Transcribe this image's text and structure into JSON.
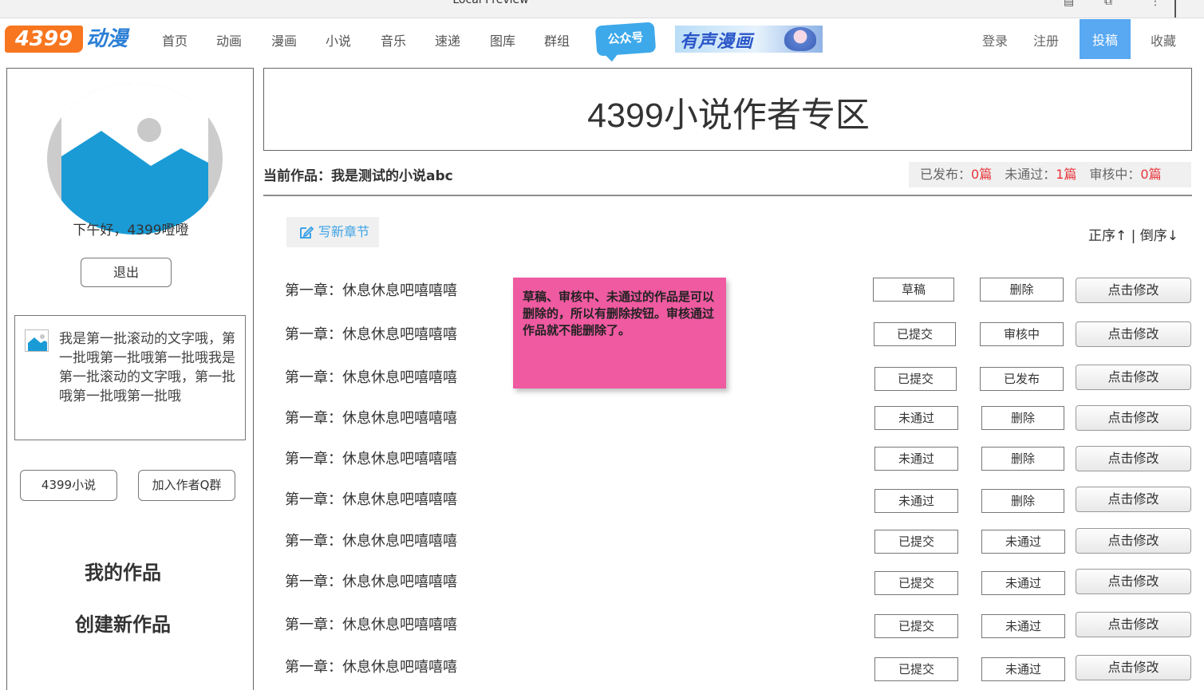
{
  "window": {
    "title": "Local Preview"
  },
  "topnav": {
    "logo_number": "4399",
    "logo_text": "动漫",
    "items": [
      "首页",
      "动画",
      "漫画",
      "小说",
      "音乐",
      "速递",
      "图库",
      "群组"
    ],
    "badge_gongzhonghao": "公众号",
    "banner_text": "有声漫画",
    "login": "登录",
    "register": "注册",
    "submit": "投稿",
    "favorites": "收藏",
    "accent_color": "#58a8f2",
    "logo_color": "#f7761f"
  },
  "sidebar": {
    "greeting": "下午好，4399噔噔",
    "logout_label": "退出",
    "scroll_text": "我是第一批滚动的文字哦，第一批哦第一批哦第一批哦我是第一批滚动的文字哦，第一批哦第一批哦第一批哦",
    "btn_novel": "4399小说",
    "btn_join_group": "加入作者Q群",
    "link_my_works": "我的作品",
    "link_create_work": "创建新作品"
  },
  "main": {
    "header_title": "4399小说作者专区",
    "current_work_label": "当前作品：",
    "current_work_name": "我是测试的小说abc",
    "stats": {
      "published_label": "已发布：",
      "published_count": "0篇",
      "rejected_label": "未通过：",
      "rejected_count": "1篇",
      "reviewing_label": "审核中：",
      "reviewing_count": "0篇",
      "highlight_color": "#e8343a"
    },
    "write_chapter_label": "写新章节",
    "sort_label": "正序↑ | 倒序↓",
    "note_text": "草稿、审核中、未通过的作品是可以删除的，所以有删除按钮。审核通过作品就不能删除了。",
    "note_color": "#ef5aa1",
    "edit_label": "点击修改",
    "chapters": [
      {
        "title": "第一章：休息休息吧嘻嘻嘻",
        "status": "草稿",
        "action": "删除"
      },
      {
        "title": "第一章：休息休息吧嘻嘻嘻",
        "status": "已提交",
        "action": "审核中"
      },
      {
        "title": "第一章：休息休息吧嘻嘻嘻",
        "status": "已提交",
        "action": "已发布"
      },
      {
        "title": "第一章：休息休息吧嘻嘻嘻",
        "status": "未通过",
        "action": "删除"
      },
      {
        "title": "第一章：休息休息吧嘻嘻嘻",
        "status": "未通过",
        "action": "删除"
      },
      {
        "title": "第一章：休息休息吧嘻嘻嘻",
        "status": "未通过",
        "action": "删除"
      },
      {
        "title": "第一章：休息休息吧嘻嘻嘻",
        "status": "已提交",
        "action": "未通过"
      },
      {
        "title": "第一章：休息休息吧嘻嘻嘻",
        "status": "已提交",
        "action": "未通过"
      },
      {
        "title": "第一章：休息休息吧嘻嘻嘻",
        "status": "已提交",
        "action": "未通过"
      },
      {
        "title": "第一章：休息休息吧嘻嘻嘻",
        "status": "已提交",
        "action": "未通过"
      }
    ]
  }
}
